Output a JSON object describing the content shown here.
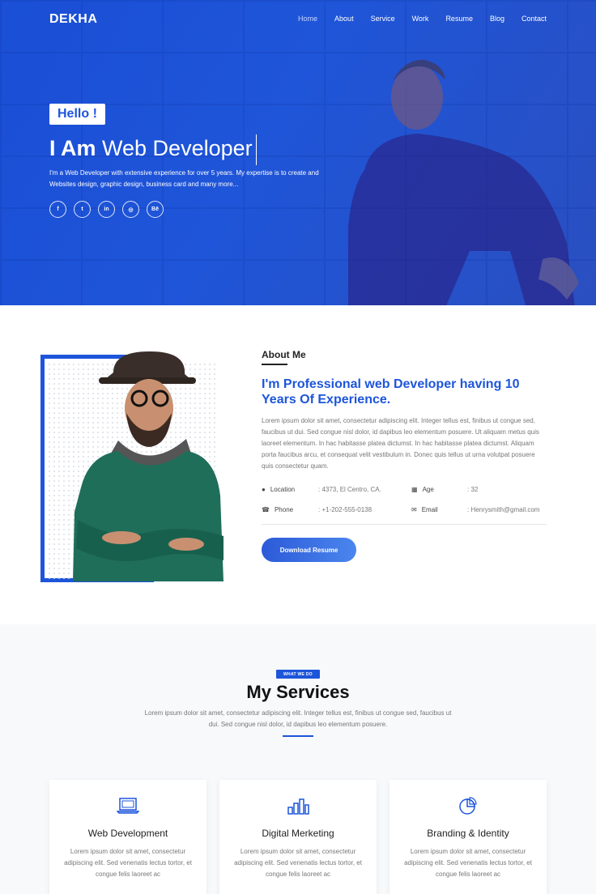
{
  "header": {
    "logo": "DEKHA",
    "nav": [
      "Home",
      "About",
      "Service",
      "Work",
      "Resume",
      "Blog",
      "Contact"
    ],
    "active_nav": "Home"
  },
  "hero": {
    "greeting": "Hello !",
    "title_bold": "I Am",
    "title_light": "Web Developer",
    "description": "I'm a Web Developer with extensive experience for over 5 years. My expertise is to create and Websites design, graphic design, business card and many more...",
    "socials": [
      {
        "icon": "facebook-icon",
        "glyph": "f"
      },
      {
        "icon": "twitter-icon",
        "glyph": "t"
      },
      {
        "icon": "linkedin-icon",
        "glyph": "in"
      },
      {
        "icon": "instagram-icon",
        "glyph": "◎"
      },
      {
        "icon": "behance-icon",
        "glyph": "Bē"
      }
    ]
  },
  "about": {
    "label": "About Me",
    "heading": "I'm Professional web Developer having 10 Years Of Experience.",
    "text": "Lorem ipsum dolor sit amet, consectetur adipiscing elit. Integer tellus est, finibus ut congue sed, faucibus ut dui. Sed congue nisl dolor, id dapibus leo elementum posuere. Ut aliquam metus quis laoreet elementum. In hac habitasse platea dictumst. In hac habitasse platea dictumst. Aliquam porta faucibus arcu, et consequat velit vestibulum in. Donec quis tellus ut urna volutpat posuere quis consectetur quam.",
    "location_label": "Location",
    "location_value": ": 4373, El Centro, CA.",
    "age_label": "Age",
    "age_value": ": 32",
    "phone_label": "Phone",
    "phone_value": ": +1-202-555-0138",
    "email_label": "Email",
    "email_value": ": Henrysmith@gmail.com",
    "button": "Download Resume"
  },
  "services": {
    "tag": "WHAT WE DO",
    "title": "My Services",
    "subtitle": "Lorem ipsum dolor sit amet, consectetur adipiscing elit. Integer tellus est, finibus ut congue sed, faucibus ut dui. Sed congue nisl dolor, id dapibus leo elementum posuere.",
    "cards": [
      {
        "title": "Web Development",
        "icon": "laptop-icon",
        "text": "Lorem ipsum dolor sit amet, consectetur adipiscing elit. Sed venenatis lectus tortor, et congue felis laoreet ac"
      },
      {
        "title": "Digital Merketing",
        "icon": "bar-chart-icon",
        "text": "Lorem ipsum dolor sit amet, consectetur adipiscing elit. Sed venenatis lectus tortor, et congue felis laoreet ac"
      },
      {
        "title": "Branding & Identity",
        "icon": "pie-chart-icon",
        "text": "Lorem ipsum dolor sit amet, consectetur adipiscing elit. Sed venenatis lectus tortor, et congue felis laoreet ac"
      }
    ]
  },
  "colors": {
    "accent": "#1d55db",
    "hero_bg": "#1f55d8",
    "services_bg": "#f8f9fb"
  }
}
